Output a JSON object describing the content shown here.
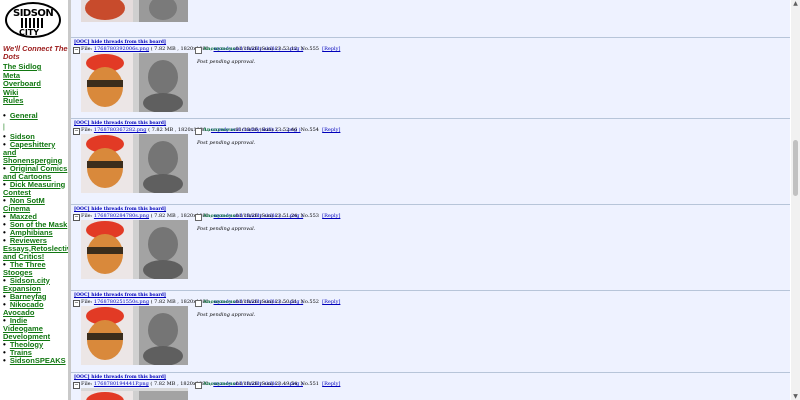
{
  "logo": {
    "top": "SIDSON",
    "bottom": "CITY"
  },
  "tagline": "We'll Connect The Dots",
  "nav_links": [
    "The Sidlog",
    "Meta",
    "Overboard",
    "Wiki",
    "Rules"
  ],
  "general": "General",
  "separator": "|",
  "boards": [
    "Sidson",
    "Capeshittery and Shonensperging",
    "Original Comics and Cartoons",
    "Dick Measuring Contest",
    "Non SotM Cinema",
    "Maxzed",
    "Son of the Mask",
    "Amphibians",
    "Reviewers Essays,Retoslective and Critics!",
    "The Three Stooges",
    "Sidson.city Expansion",
    "Barneyfag",
    "Nikocado Avocado",
    "Indie Videogame Development",
    "Theology",
    "Trains",
    "SidsonSPEAKS"
  ],
  "threads": [
    {
      "ooc": "[OOC] hide threads from this board]",
      "file_label": "File:",
      "filename": "1768780392006s.png",
      "fileinfo": "( 7.82 MB , 1820x1080 ,",
      "subject": "unzedy and chaddy skills ( ... .png )",
      "name": "Anonymous",
      "date": "01/18/26 (Sun) 23:53:12",
      "no": "No.555",
      "reply": "[Reply]",
      "status": "Post pending approval."
    },
    {
      "ooc": "[OOC] hide threads from this board]",
      "file_label": "File:",
      "filename": "1768780367282.png",
      "fileinfo": "( 7.82 MB , 1820x1080 ,",
      "subject": "unzedy and chaddy skills ( ... .png )",
      "name": "Anonymous",
      "date": "01/18/26 (Sun) 23:52:46",
      "no": "No.554",
      "reply": "[Reply]",
      "status": "Post pending approval."
    },
    {
      "ooc": "[OOC] hide threads from this board]",
      "file_label": "File:",
      "filename": "1768780284780s.png",
      "fileinfo": "( 7.82 MB , 1820x1080 ,",
      "subject": "unzedy and chaddy skills ( ... .png )",
      "name": "Anonymous",
      "date": "01/18/26 (Sun) 23:51:24",
      "no": "No.553",
      "reply": "[Reply]",
      "status": "Post pending approval."
    },
    {
      "ooc": "[OOC] hide threads from this board]",
      "file_label": "File:",
      "filename": "1768780251550s.png",
      "fileinfo": "( 7.82 MB , 1820x1080 ,",
      "subject": "unzedy and chaddy skills ( ... .png )",
      "name": "Anonymous",
      "date": "01/18/26 (Sun) 23:50:51",
      "no": "No.552",
      "reply": "[Reply]",
      "status": "Post pending approval."
    },
    {
      "ooc": "[OOC] hide threads from this board]",
      "file_label": "File:",
      "filename": "1768780194441P.png",
      "fileinfo": "( 7.82 MB , 1820x1080 ,",
      "subject": "unzedy and chaddy skills ( ... .png )",
      "name": "Anonymous",
      "date": "01/18/26 (Sun) 23:49:54",
      "no": "No.551",
      "reply": "[Reply]",
      "status": ""
    }
  ]
}
